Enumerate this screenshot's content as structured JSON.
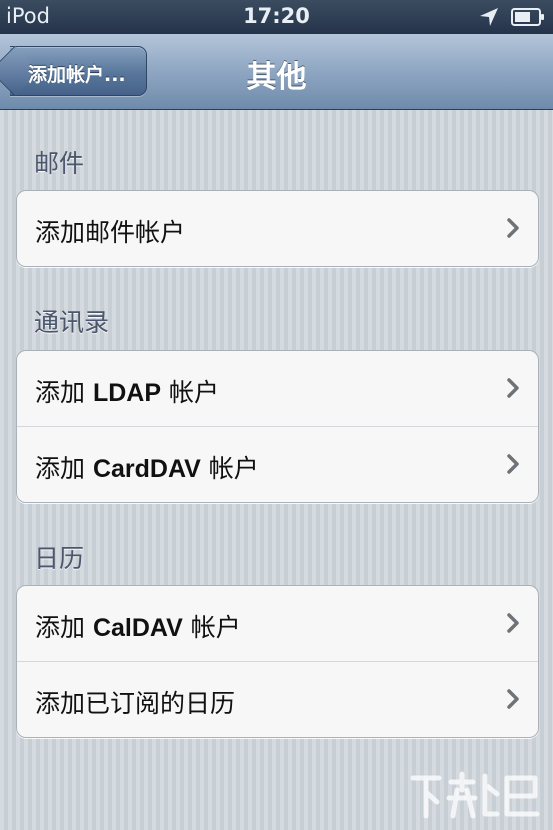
{
  "status_bar": {
    "carrier": "iPod",
    "time": "17:20",
    "location_icon": "location-arrow-icon",
    "battery_icon": "battery-icon"
  },
  "nav": {
    "back_label": "添加帐户...",
    "title": "其他"
  },
  "sections": [
    {
      "header": "邮件",
      "rows": [
        {
          "label": "添加邮件帐户"
        }
      ]
    },
    {
      "header": "通讯录",
      "rows": [
        {
          "pre": "添加 ",
          "strong": "LDAP",
          "post": " 帐户"
        },
        {
          "pre": "添加 ",
          "strong": "CardDAV",
          "post": " 帐户"
        }
      ]
    },
    {
      "header": "日历",
      "rows": [
        {
          "pre": "添加 ",
          "strong": "CalDAV",
          "post": " 帐户"
        },
        {
          "label": "添加已订阅的日历"
        }
      ]
    }
  ],
  "colors": {
    "nav_top": "#b4c5d9",
    "nav_bottom": "#6f8bab",
    "status_bar": "#2a3a50",
    "background": "#cbd2d8",
    "section_header": "#4c566c",
    "chevron": "#6e7378"
  },
  "watermark_icon": "watermark-logo-icon"
}
